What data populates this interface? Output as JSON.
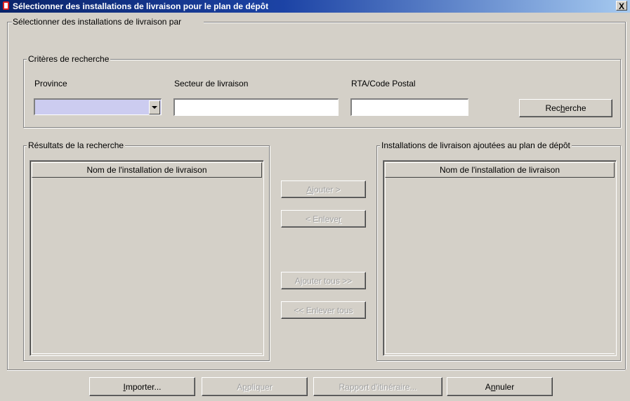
{
  "window": {
    "title": "Sélectionner des installations de livraison pour le plan de dépôt",
    "close_label": "X"
  },
  "outer_group": {
    "label": "Sélectionner des installations de livraison par"
  },
  "criteria": {
    "label": "Critères de recherche",
    "province_label": "Province",
    "province_value": "",
    "sector_label": "Secteur de livraison",
    "sector_value": "",
    "rta_label": "RTA/Code Postal",
    "rta_value": "",
    "search_button": {
      "pre": "Rec",
      "mn": "h",
      "post": "erche"
    }
  },
  "results": {
    "label": "Résultats de la recherche",
    "column_header": "Nom de l'installation de livraison",
    "rows": []
  },
  "added": {
    "label": "Installations de livraison ajoutées au plan de dépôt",
    "column_header": "Nom de l'installation de livraison",
    "rows": []
  },
  "transfer_buttons": {
    "add": {
      "pre": "",
      "mn": "A",
      "post": "jouter >"
    },
    "remove": {
      "pre": "< Enleve",
      "mn": "r",
      "post": ""
    },
    "add_all": {
      "pre": "Ajouter tous >>",
      "mn": "",
      "post": ""
    },
    "remove_all": {
      "pre": "<< Enlever tous",
      "mn": "",
      "post": ""
    }
  },
  "footer_buttons": {
    "import": {
      "pre": "",
      "mn": "I",
      "post": "mporter..."
    },
    "apply": {
      "pre": "A",
      "mn": "p",
      "post": "pliquer"
    },
    "report": {
      "pre": "Rapport d'itinéraire...",
      "mn": "",
      "post": ""
    },
    "cancel": {
      "pre": "A",
      "mn": "n",
      "post": "nuler"
    }
  },
  "colors": {
    "window_bg": "#d4d0c8",
    "titlebar": "#0a246a",
    "combo_bg": "#ccccf0",
    "disabled_text": "#a0a0a0"
  }
}
